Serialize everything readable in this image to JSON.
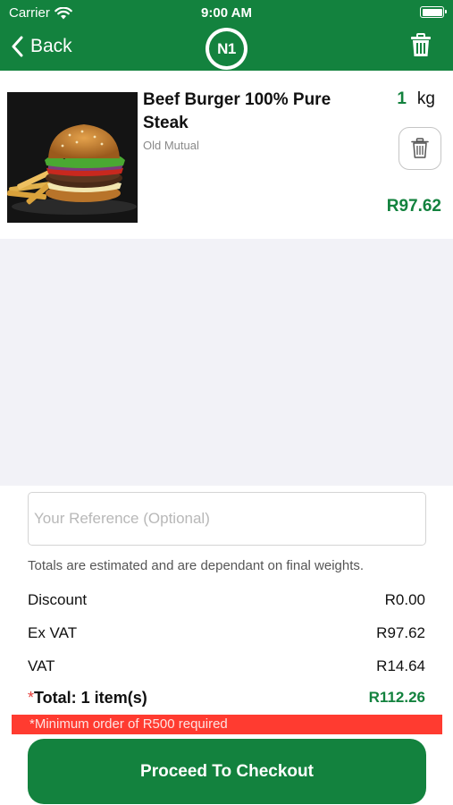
{
  "status_bar": {
    "carrier": "Carrier",
    "time": "9:00 AM"
  },
  "nav": {
    "back_label": "Back",
    "logo_text": "N1"
  },
  "cart_item": {
    "name": "Beef Burger 100% Pure Steak",
    "vendor": "Old Mutual",
    "quantity": "1",
    "unit": "kg",
    "price": "R97.62",
    "image": "burger-and-fries-photo"
  },
  "summary": {
    "reference_placeholder": "Your Reference (Optional)",
    "note": "Totals are estimated and are dependant on final weights.",
    "discount_label": "Discount",
    "discount_value": "R0.00",
    "exvat_label": "Ex VAT",
    "exvat_value": "R97.62",
    "vat_label": "VAT",
    "vat_value": "R14.64",
    "total_label": "Total: 1 item(s)",
    "total_value": "R112.26",
    "warning": "*Minimum order of R500 required",
    "checkout_label": "Proceed To Checkout"
  },
  "colors": {
    "brand": "#13823e",
    "warning": "#ff3b30",
    "background": "#f2f2f7"
  }
}
